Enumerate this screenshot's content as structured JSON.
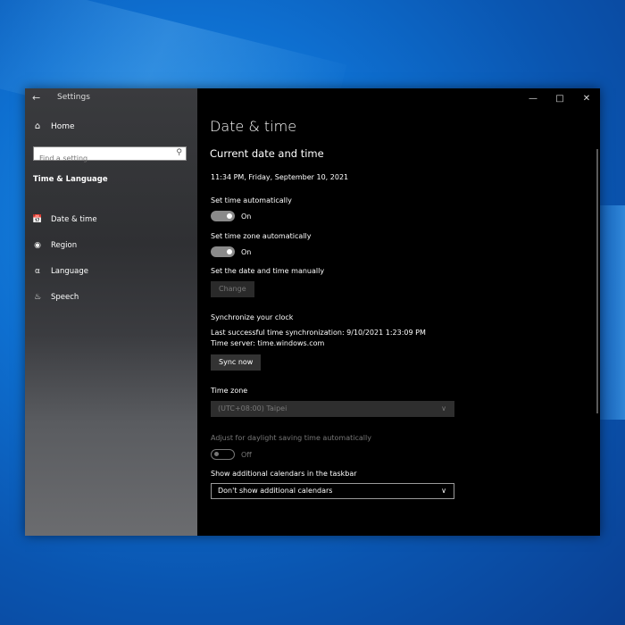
{
  "window": {
    "title": "Settings"
  },
  "sidebar": {
    "home_label": "Home",
    "search_placeholder": "Find a setting",
    "section": "Time & Language",
    "items": [
      {
        "label": "Date & time",
        "icon": "calendar-clock-icon"
      },
      {
        "label": "Region",
        "icon": "globe-icon"
      },
      {
        "label": "Language",
        "icon": "language-icon"
      },
      {
        "label": "Speech",
        "icon": "microphone-icon"
      }
    ]
  },
  "main": {
    "page_title": "Date & time",
    "current_section": "Current date and time",
    "current_datetime": "11:34 PM, Friday, September 10, 2021",
    "set_time_auto": {
      "label": "Set time automatically",
      "state": "On"
    },
    "set_tz_auto": {
      "label": "Set time zone automatically",
      "state": "On"
    },
    "manual": {
      "label": "Set the date and time manually",
      "button": "Change"
    },
    "sync": {
      "heading": "Synchronize your clock",
      "last_sync": "Last successful time synchronization: 9/10/2021 1:23:09 PM",
      "server": "Time server: time.windows.com",
      "button": "Sync now"
    },
    "timezone": {
      "label": "Time zone",
      "value": "(UTC+08:00) Taipei"
    },
    "dst": {
      "label": "Adjust for daylight saving time automatically",
      "state": "Off"
    },
    "calendars": {
      "label": "Show additional calendars in the taskbar",
      "value": "Don't show additional calendars"
    }
  },
  "colors": {
    "window_bg": "#000000",
    "toggle_on": "#8a8a8a",
    "disabled_text": "#777777"
  }
}
